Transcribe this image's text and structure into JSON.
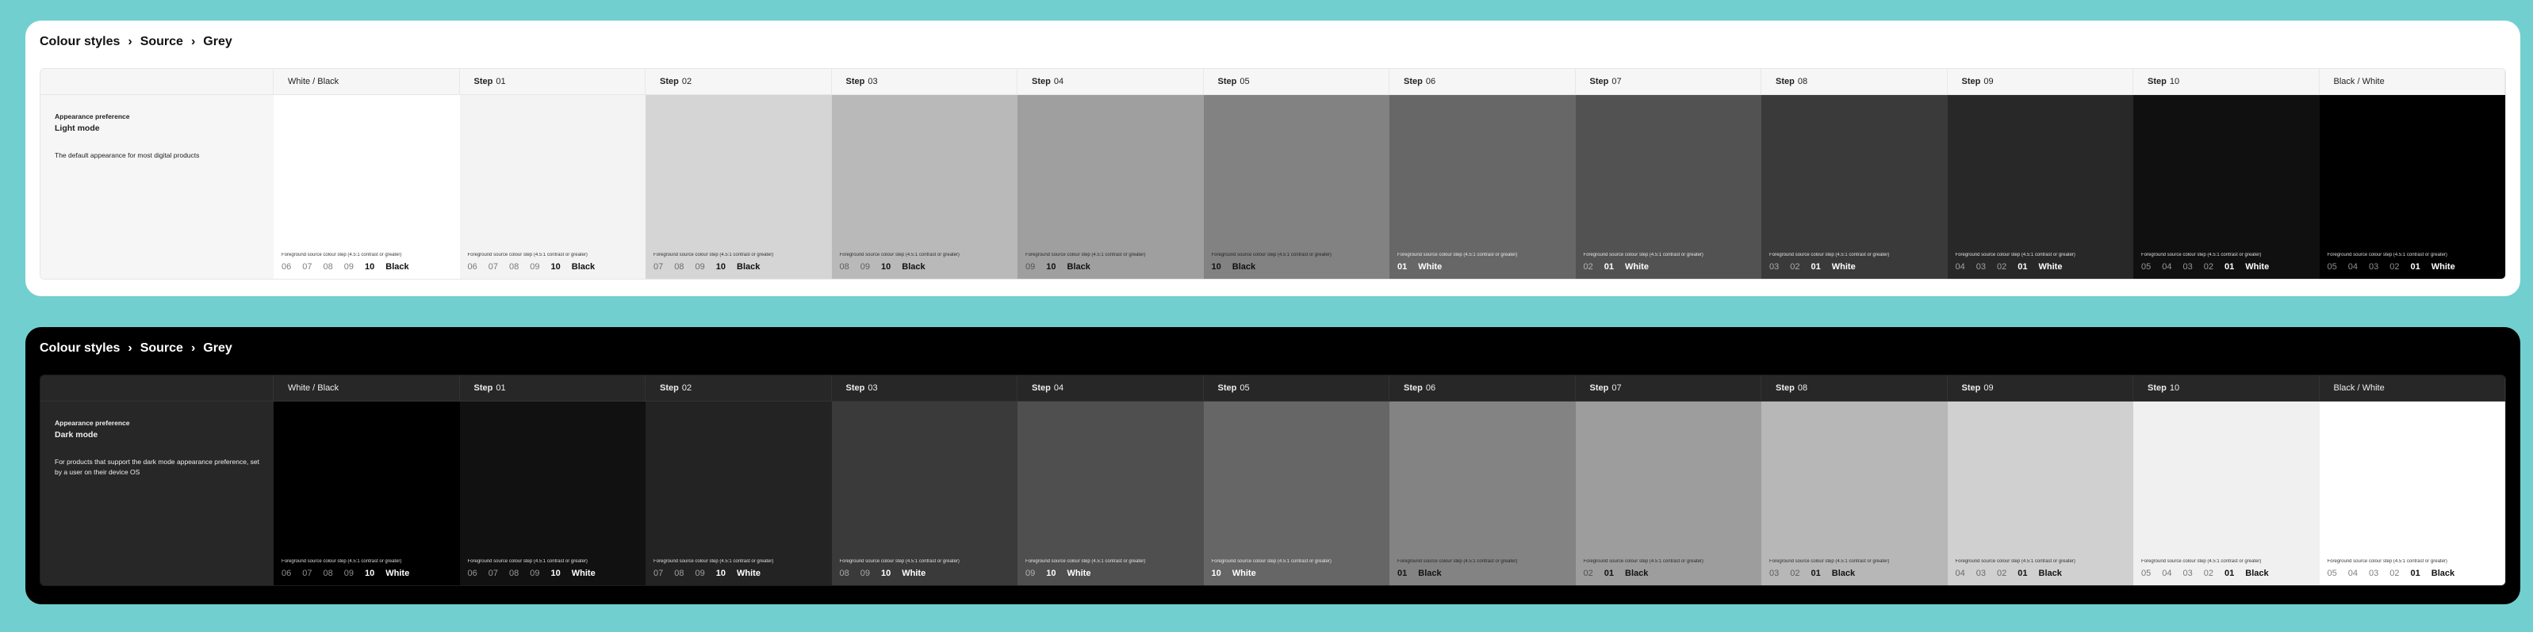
{
  "light": {
    "breadcrumb": [
      "Colour styles",
      "Source",
      "Grey"
    ],
    "description": {
      "pref": "Appearance preference",
      "mode": "Light mode",
      "text": "The default appearance for most digital products"
    },
    "fg_label": "Foreground source colour step (4.5:1 contrast or greater)",
    "columns": [
      {
        "plain": "White / Black",
        "step": "",
        "num": "",
        "bg": "#ffffff",
        "fg": "#111111",
        "steps": [
          "06",
          "07",
          "08",
          "09",
          "10"
        ],
        "final": "Black"
      },
      {
        "plain": "",
        "step": "Step",
        "num": "01",
        "bg": "#f3f3f3",
        "fg": "#111111",
        "steps": [
          "06",
          "07",
          "08",
          "09",
          "10"
        ],
        "final": "Black"
      },
      {
        "plain": "",
        "step": "Step",
        "num": "02",
        "bg": "#d5d5d5",
        "fg": "#111111",
        "steps": [
          "07",
          "08",
          "09",
          "10"
        ],
        "final": "Black"
      },
      {
        "plain": "",
        "step": "Step",
        "num": "03",
        "bg": "#b9b9b9",
        "fg": "#111111",
        "steps": [
          "08",
          "09",
          "10"
        ],
        "final": "Black"
      },
      {
        "plain": "",
        "step": "Step",
        "num": "04",
        "bg": "#9f9f9f",
        "fg": "#111111",
        "steps": [
          "09",
          "10"
        ],
        "final": "Black"
      },
      {
        "plain": "",
        "step": "Step",
        "num": "05",
        "bg": "#828282",
        "fg": "#111111",
        "steps": [
          "10"
        ],
        "final": "Black"
      },
      {
        "plain": "",
        "step": "Step",
        "num": "06",
        "bg": "#676767",
        "fg": "#ffffff",
        "steps": [
          "01"
        ],
        "final": "White"
      },
      {
        "plain": "",
        "step": "Step",
        "num": "07",
        "bg": "#525252",
        "fg": "#ffffff",
        "steps": [
          "02",
          "01"
        ],
        "final": "White"
      },
      {
        "plain": "",
        "step": "Step",
        "num": "08",
        "bg": "#3a3a3a",
        "fg": "#ffffff",
        "steps": [
          "03",
          "02",
          "01"
        ],
        "final": "White"
      },
      {
        "plain": "",
        "step": "Step",
        "num": "09",
        "bg": "#282828",
        "fg": "#ffffff",
        "steps": [
          "04",
          "03",
          "02",
          "01"
        ],
        "final": "White"
      },
      {
        "plain": "",
        "step": "Step",
        "num": "10",
        "bg": "#101010",
        "fg": "#ffffff",
        "steps": [
          "05",
          "04",
          "03",
          "02",
          "01"
        ],
        "final": "White"
      },
      {
        "plain": "Black / White",
        "step": "",
        "num": "",
        "bg": "#000000",
        "fg": "#ffffff",
        "steps": [
          "05",
          "04",
          "03",
          "02",
          "01"
        ],
        "final": "White"
      }
    ]
  },
  "dark": {
    "breadcrumb": [
      "Colour styles",
      "Source",
      "Grey"
    ],
    "description": {
      "pref": "Appearance preference",
      "mode": "Dark mode",
      "text": "For products that support the dark mode appearance preference, set by a user on their device OS"
    },
    "fg_label": "Foreground source colour step (4.5:1 contrast or greater)",
    "columns": [
      {
        "plain": "White / Black",
        "step": "",
        "num": "",
        "bg": "#000000",
        "fg": "#ffffff",
        "steps": [
          "06",
          "07",
          "08",
          "09",
          "10"
        ],
        "final": "White"
      },
      {
        "plain": "",
        "step": "Step",
        "num": "01",
        "bg": "#111111",
        "fg": "#ffffff",
        "steps": [
          "06",
          "07",
          "08",
          "09",
          "10"
        ],
        "final": "White"
      },
      {
        "plain": "",
        "step": "Step",
        "num": "02",
        "bg": "#232323",
        "fg": "#ffffff",
        "steps": [
          "07",
          "08",
          "09",
          "10"
        ],
        "final": "White"
      },
      {
        "plain": "",
        "step": "Step",
        "num": "03",
        "bg": "#3a3a3a",
        "fg": "#ffffff",
        "steps": [
          "08",
          "09",
          "10"
        ],
        "final": "White"
      },
      {
        "plain": "",
        "step": "Step",
        "num": "04",
        "bg": "#4f4f4f",
        "fg": "#ffffff",
        "steps": [
          "09",
          "10"
        ],
        "final": "White"
      },
      {
        "plain": "",
        "step": "Step",
        "num": "05",
        "bg": "#666666",
        "fg": "#ffffff",
        "steps": [
          "10"
        ],
        "final": "White"
      },
      {
        "plain": "",
        "step": "Step",
        "num": "06",
        "bg": "#838383",
        "fg": "#111111",
        "steps": [
          "01"
        ],
        "final": "Black"
      },
      {
        "plain": "",
        "step": "Step",
        "num": "07",
        "bg": "#9d9d9d",
        "fg": "#111111",
        "steps": [
          "02",
          "01"
        ],
        "final": "Black"
      },
      {
        "plain": "",
        "step": "Step",
        "num": "08",
        "bg": "#b7b7b7",
        "fg": "#111111",
        "steps": [
          "03",
          "02",
          "01"
        ],
        "final": "Black"
      },
      {
        "plain": "",
        "step": "Step",
        "num": "09",
        "bg": "#d0d0d0",
        "fg": "#111111",
        "steps": [
          "04",
          "03",
          "02",
          "01"
        ],
        "final": "Black"
      },
      {
        "plain": "",
        "step": "Step",
        "num": "10",
        "bg": "#f0f0f0",
        "fg": "#111111",
        "steps": [
          "05",
          "04",
          "03",
          "02",
          "01"
        ],
        "final": "Black"
      },
      {
        "plain": "Black / White",
        "step": "",
        "num": "",
        "bg": "#ffffff",
        "fg": "#111111",
        "steps": [
          "05",
          "04",
          "03",
          "02",
          "01"
        ],
        "final": "Black"
      }
    ]
  }
}
